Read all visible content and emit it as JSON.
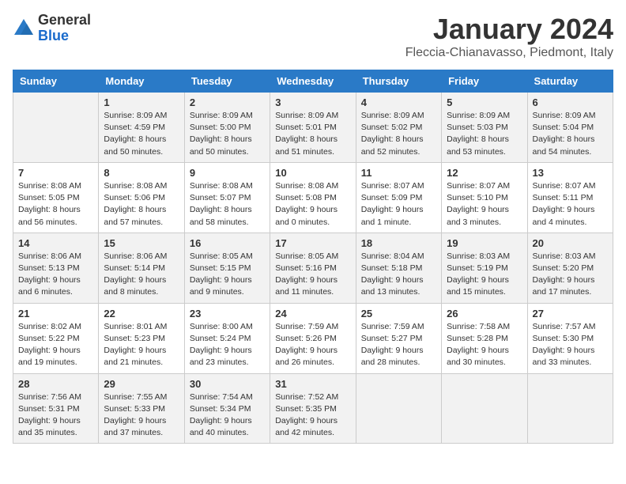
{
  "logo": {
    "general": "General",
    "blue": "Blue"
  },
  "header": {
    "month": "January 2024",
    "location": "Fleccia-Chianavasso, Piedmont, Italy"
  },
  "weekdays": [
    "Sunday",
    "Monday",
    "Tuesday",
    "Wednesday",
    "Thursday",
    "Friday",
    "Saturday"
  ],
  "weeks": [
    [
      {
        "day": "",
        "sunrise": "",
        "sunset": "",
        "daylight": ""
      },
      {
        "day": "1",
        "sunrise": "Sunrise: 8:09 AM",
        "sunset": "Sunset: 4:59 PM",
        "daylight": "Daylight: 8 hours and 50 minutes."
      },
      {
        "day": "2",
        "sunrise": "Sunrise: 8:09 AM",
        "sunset": "Sunset: 5:00 PM",
        "daylight": "Daylight: 8 hours and 50 minutes."
      },
      {
        "day": "3",
        "sunrise": "Sunrise: 8:09 AM",
        "sunset": "Sunset: 5:01 PM",
        "daylight": "Daylight: 8 hours and 51 minutes."
      },
      {
        "day": "4",
        "sunrise": "Sunrise: 8:09 AM",
        "sunset": "Sunset: 5:02 PM",
        "daylight": "Daylight: 8 hours and 52 minutes."
      },
      {
        "day": "5",
        "sunrise": "Sunrise: 8:09 AM",
        "sunset": "Sunset: 5:03 PM",
        "daylight": "Daylight: 8 hours and 53 minutes."
      },
      {
        "day": "6",
        "sunrise": "Sunrise: 8:09 AM",
        "sunset": "Sunset: 5:04 PM",
        "daylight": "Daylight: 8 hours and 54 minutes."
      }
    ],
    [
      {
        "day": "7",
        "sunrise": "Sunrise: 8:08 AM",
        "sunset": "Sunset: 5:05 PM",
        "daylight": "Daylight: 8 hours and 56 minutes."
      },
      {
        "day": "8",
        "sunrise": "Sunrise: 8:08 AM",
        "sunset": "Sunset: 5:06 PM",
        "daylight": "Daylight: 8 hours and 57 minutes."
      },
      {
        "day": "9",
        "sunrise": "Sunrise: 8:08 AM",
        "sunset": "Sunset: 5:07 PM",
        "daylight": "Daylight: 8 hours and 58 minutes."
      },
      {
        "day": "10",
        "sunrise": "Sunrise: 8:08 AM",
        "sunset": "Sunset: 5:08 PM",
        "daylight": "Daylight: 9 hours and 0 minutes."
      },
      {
        "day": "11",
        "sunrise": "Sunrise: 8:07 AM",
        "sunset": "Sunset: 5:09 PM",
        "daylight": "Daylight: 9 hours and 1 minute."
      },
      {
        "day": "12",
        "sunrise": "Sunrise: 8:07 AM",
        "sunset": "Sunset: 5:10 PM",
        "daylight": "Daylight: 9 hours and 3 minutes."
      },
      {
        "day": "13",
        "sunrise": "Sunrise: 8:07 AM",
        "sunset": "Sunset: 5:11 PM",
        "daylight": "Daylight: 9 hours and 4 minutes."
      }
    ],
    [
      {
        "day": "14",
        "sunrise": "Sunrise: 8:06 AM",
        "sunset": "Sunset: 5:13 PM",
        "daylight": "Daylight: 9 hours and 6 minutes."
      },
      {
        "day": "15",
        "sunrise": "Sunrise: 8:06 AM",
        "sunset": "Sunset: 5:14 PM",
        "daylight": "Daylight: 9 hours and 8 minutes."
      },
      {
        "day": "16",
        "sunrise": "Sunrise: 8:05 AM",
        "sunset": "Sunset: 5:15 PM",
        "daylight": "Daylight: 9 hours and 9 minutes."
      },
      {
        "day": "17",
        "sunrise": "Sunrise: 8:05 AM",
        "sunset": "Sunset: 5:16 PM",
        "daylight": "Daylight: 9 hours and 11 minutes."
      },
      {
        "day": "18",
        "sunrise": "Sunrise: 8:04 AM",
        "sunset": "Sunset: 5:18 PM",
        "daylight": "Daylight: 9 hours and 13 minutes."
      },
      {
        "day": "19",
        "sunrise": "Sunrise: 8:03 AM",
        "sunset": "Sunset: 5:19 PM",
        "daylight": "Daylight: 9 hours and 15 minutes."
      },
      {
        "day": "20",
        "sunrise": "Sunrise: 8:03 AM",
        "sunset": "Sunset: 5:20 PM",
        "daylight": "Daylight: 9 hours and 17 minutes."
      }
    ],
    [
      {
        "day": "21",
        "sunrise": "Sunrise: 8:02 AM",
        "sunset": "Sunset: 5:22 PM",
        "daylight": "Daylight: 9 hours and 19 minutes."
      },
      {
        "day": "22",
        "sunrise": "Sunrise: 8:01 AM",
        "sunset": "Sunset: 5:23 PM",
        "daylight": "Daylight: 9 hours and 21 minutes."
      },
      {
        "day": "23",
        "sunrise": "Sunrise: 8:00 AM",
        "sunset": "Sunset: 5:24 PM",
        "daylight": "Daylight: 9 hours and 23 minutes."
      },
      {
        "day": "24",
        "sunrise": "Sunrise: 7:59 AM",
        "sunset": "Sunset: 5:26 PM",
        "daylight": "Daylight: 9 hours and 26 minutes."
      },
      {
        "day": "25",
        "sunrise": "Sunrise: 7:59 AM",
        "sunset": "Sunset: 5:27 PM",
        "daylight": "Daylight: 9 hours and 28 minutes."
      },
      {
        "day": "26",
        "sunrise": "Sunrise: 7:58 AM",
        "sunset": "Sunset: 5:28 PM",
        "daylight": "Daylight: 9 hours and 30 minutes."
      },
      {
        "day": "27",
        "sunrise": "Sunrise: 7:57 AM",
        "sunset": "Sunset: 5:30 PM",
        "daylight": "Daylight: 9 hours and 33 minutes."
      }
    ],
    [
      {
        "day": "28",
        "sunrise": "Sunrise: 7:56 AM",
        "sunset": "Sunset: 5:31 PM",
        "daylight": "Daylight: 9 hours and 35 minutes."
      },
      {
        "day": "29",
        "sunrise": "Sunrise: 7:55 AM",
        "sunset": "Sunset: 5:33 PM",
        "daylight": "Daylight: 9 hours and 37 minutes."
      },
      {
        "day": "30",
        "sunrise": "Sunrise: 7:54 AM",
        "sunset": "Sunset: 5:34 PM",
        "daylight": "Daylight: 9 hours and 40 minutes."
      },
      {
        "day": "31",
        "sunrise": "Sunrise: 7:52 AM",
        "sunset": "Sunset: 5:35 PM",
        "daylight": "Daylight: 9 hours and 42 minutes."
      },
      {
        "day": "",
        "sunrise": "",
        "sunset": "",
        "daylight": ""
      },
      {
        "day": "",
        "sunrise": "",
        "sunset": "",
        "daylight": ""
      },
      {
        "day": "",
        "sunrise": "",
        "sunset": "",
        "daylight": ""
      }
    ]
  ]
}
